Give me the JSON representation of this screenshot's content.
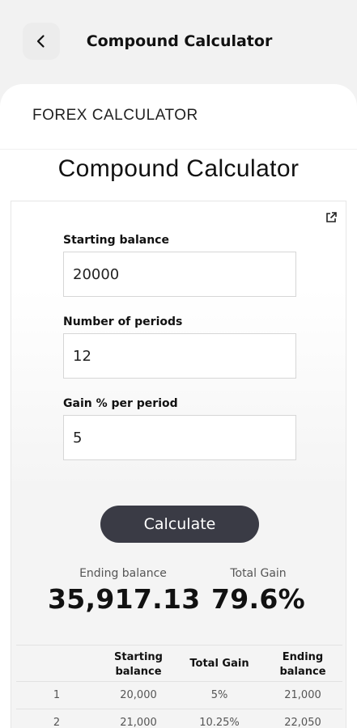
{
  "header": {
    "title": "Compound Calculator",
    "back_icon": "chevron-left-icon"
  },
  "card": {
    "label": "FOREX CALCULATOR",
    "section_title": "Compound Calculator",
    "external_icon": "external-link-icon"
  },
  "form": {
    "starting_balance_label": "Starting balance",
    "starting_balance_value": "20000",
    "periods_label": "Number of periods",
    "periods_value": "12",
    "gain_label": "Gain % per period",
    "gain_value": "5"
  },
  "actions": {
    "calculate_label": "Calculate"
  },
  "results": {
    "ending_balance_label": "Ending balance",
    "ending_balance_value": "35,917.13",
    "total_gain_label": "Total Gain",
    "total_gain_value": "79.6%"
  },
  "table": {
    "headers": [
      "",
      "Starting balance",
      "Total Gain",
      "Ending balance"
    ],
    "rows": [
      [
        "1",
        "20,000",
        "5%",
        "21,000"
      ],
      [
        "2",
        "21,000",
        "10.25%",
        "22,050"
      ]
    ]
  },
  "colors": {
    "background": "#f2f2f2",
    "button": "#3a3b45"
  }
}
